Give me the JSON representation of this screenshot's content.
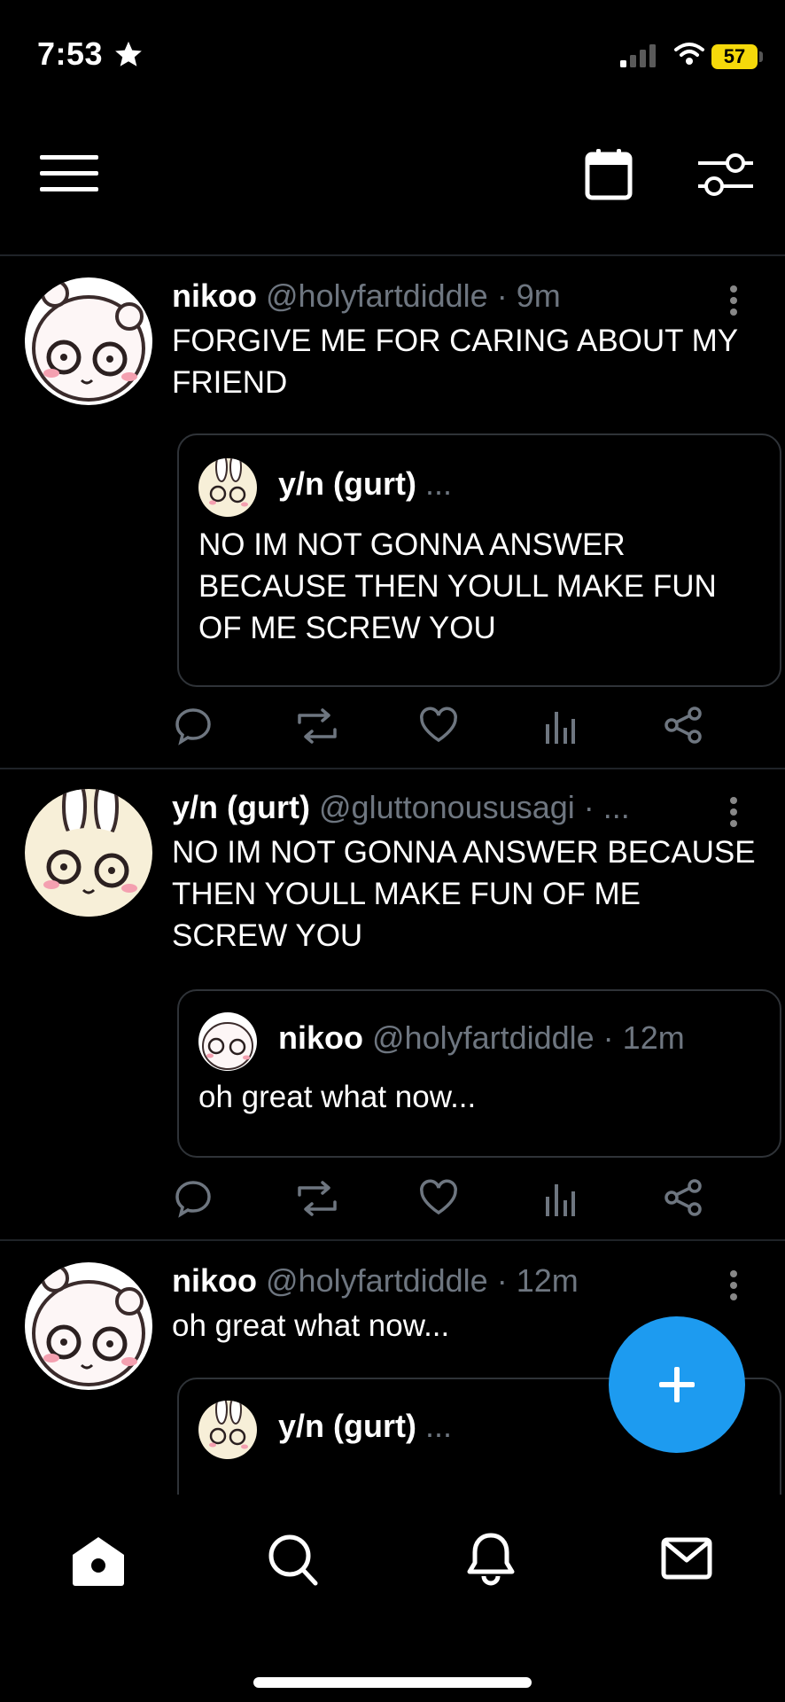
{
  "status_bar": {
    "time": "7:53",
    "battery": "57"
  },
  "posts": [
    {
      "author": "nikoo",
      "handle": "@holyfartdiddle",
      "meta": " · 9m",
      "text": "FORGIVE ME FOR CARING ABOUT MY FRIEND",
      "quote": {
        "author": "y/n (gurt)",
        "meta": " ...",
        "text": "NO IM NOT GONNA ANSWER BECAUSE THEN YOULL MAKE FUN OF ME SCREW YOU"
      }
    },
    {
      "author": "y/n (gurt)",
      "handle": "@gluttonoususagi",
      "meta": " · ...",
      "text": "NO IM NOT GONNA ANSWER BECAUSE THEN YOULL MAKE FUN OF ME SCREW YOU",
      "quote": {
        "author": "nikoo",
        "meta": " @holyfartdiddle · 12m",
        "text": "oh great what now..."
      }
    },
    {
      "author": "nikoo",
      "handle": "@holyfartdiddle",
      "meta": " · 12m",
      "text": "oh great what now...",
      "quote": {
        "author": "y/n (gurt)",
        "meta": " ..."
      }
    }
  ],
  "icons": {
    "top_nav": [
      "menu-icon",
      "calendar-icon",
      "filter-icon"
    ],
    "post_actions": [
      "reply-icon",
      "repost-icon",
      "like-icon",
      "stats-icon",
      "share-icon"
    ],
    "tab_bar": [
      "home-icon",
      "search-icon",
      "notifications-icon",
      "messages-icon"
    ],
    "fab": "plus-icon"
  },
  "colors": {
    "accent": "#1d9bf0",
    "background": "#000000",
    "muted_text": "#6e7680",
    "battery": "#f5d90a"
  }
}
